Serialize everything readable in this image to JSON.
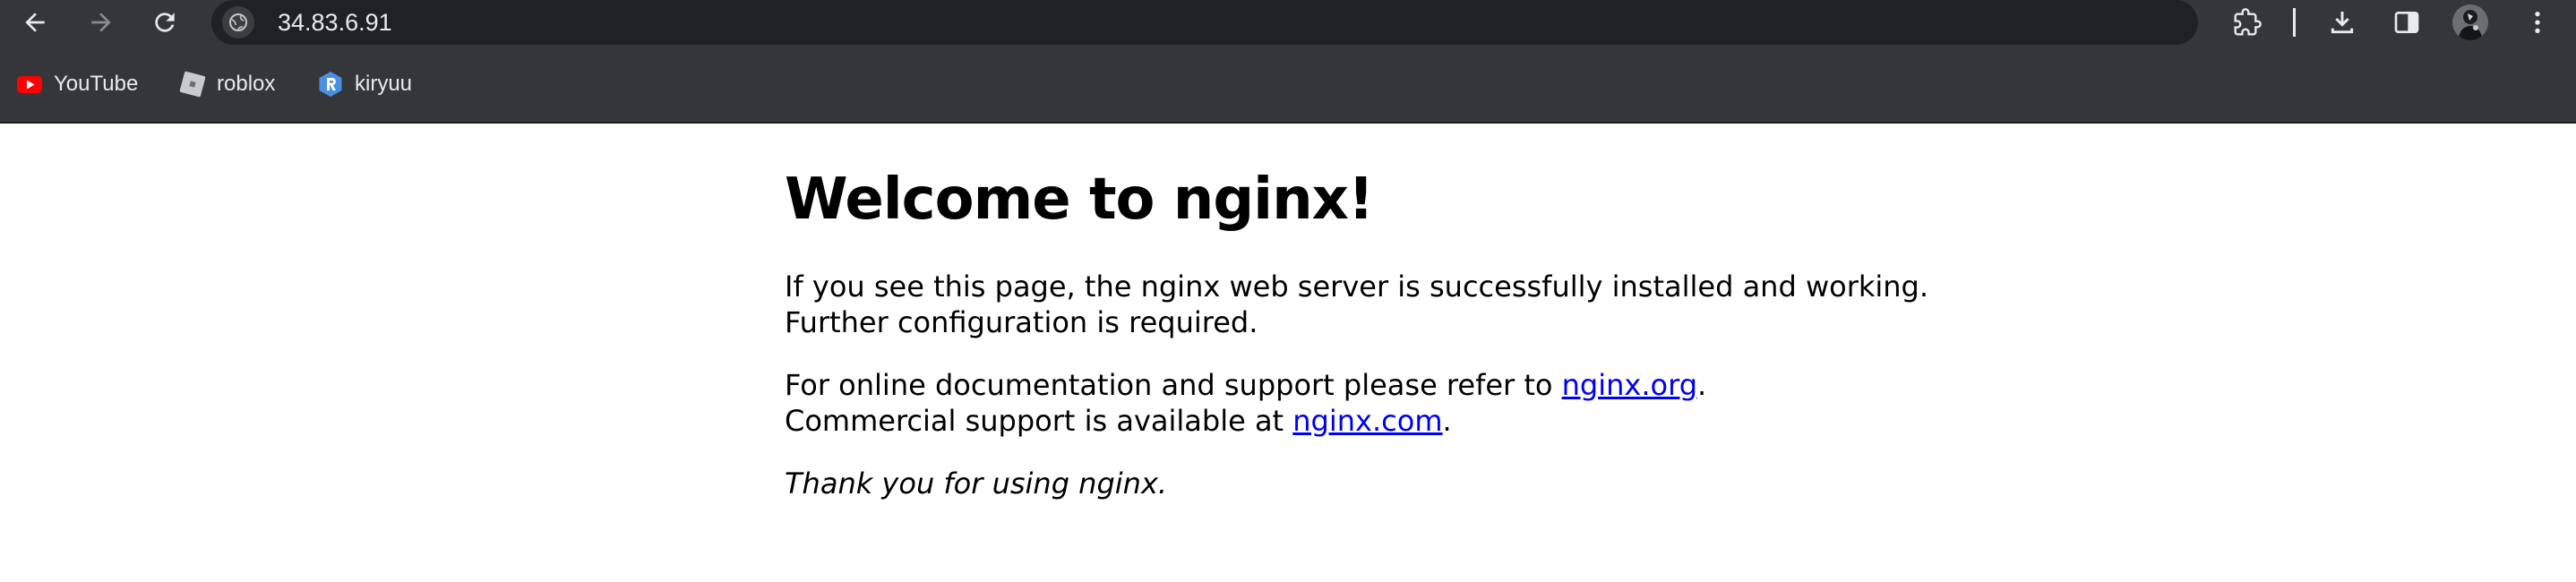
{
  "browser": {
    "url": "34.83.6.91",
    "bookmarks": [
      {
        "label": "YouTube",
        "icon": "youtube-icon"
      },
      {
        "label": "roblox",
        "icon": "roblox-icon"
      },
      {
        "label": "kiryuu",
        "icon": "kiryuu-icon"
      }
    ],
    "toolbar_icons": [
      "back-arrow-icon",
      "forward-arrow-icon",
      "reload-icon",
      "site-info-icon",
      "extensions-icon",
      "download-icon",
      "side-panel-icon",
      "profile-avatar",
      "more-menu-icon"
    ],
    "colors": {
      "chrome": "#35363a",
      "omnibox": "#202124",
      "text": "#e8eaed",
      "youtube": "#ff0000",
      "kiryuu": "#4a90e2"
    }
  },
  "page": {
    "heading": "Welcome to nginx!",
    "para1": "If you see this page, the nginx web server is successfully installed and working. Further configuration is required.",
    "para2_prefix": "For online documentation and support please refer to ",
    "link1": "nginx.org",
    "para2_mid": ".",
    "para2_line2": "Commercial support is available at ",
    "link2": "nginx.com",
    "para2_end": ".",
    "para3": "Thank you for using nginx.",
    "link_color": "#0000ee"
  }
}
